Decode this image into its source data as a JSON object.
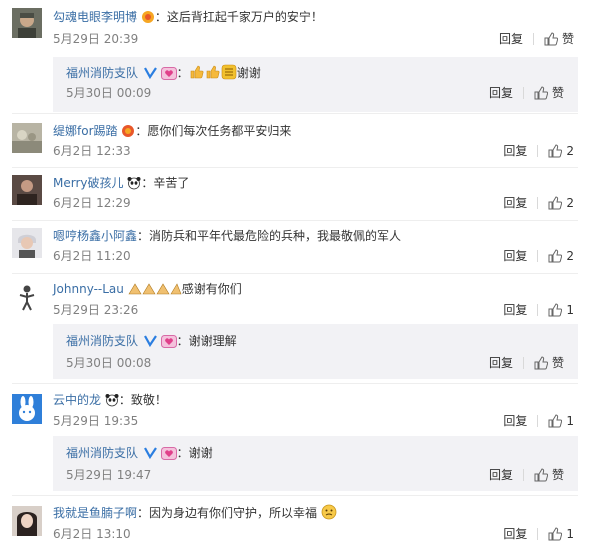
{
  "comments": [
    {
      "user": "勾魂电眼李明博",
      "text": "：这后背扛起千家万户的安宁！",
      "time": "5月29日 20:39",
      "reply": "回复",
      "like": "赞"
    },
    {
      "user": "缇娜for踢踏",
      "text": "：愿你们每次任务都平安归来",
      "time": "6月2日 12:33",
      "reply": "回复",
      "like": "2"
    },
    {
      "user": "Merry破孩儿",
      "text": "：辛苦了",
      "time": "6月2日 12:29",
      "reply": "回复",
      "like": "2"
    },
    {
      "user": "嗯哼杨鑫小阿鑫",
      "text": "：消防兵和平年代最危险的兵种，我最敬佩的军人",
      "time": "6月2日 11:20",
      "reply": "回复",
      "like": "2"
    },
    {
      "user": "Johnny--Lau",
      "text": "感谢有你们",
      "time": "5月29日 23:26",
      "reply": "回复",
      "like": "1"
    },
    {
      "user": "云中的龙",
      "text": "：致敬！",
      "time": "5月29日 19:35",
      "reply": "回复",
      "like": "1"
    },
    {
      "user": "我就是鱼腩子啊",
      "text": "：因为身边有你们守护，所以幸福",
      "time": "6月2日 13:10",
      "reply": "回复",
      "like": "1"
    }
  ],
  "replies": [
    {
      "user": "福州消防支队",
      "text": "谢谢",
      "time": "5月30日 00:09",
      "reply": "回复",
      "like": "赞"
    },
    {
      "user": "福州消防支队",
      "text": "：谢谢理解",
      "time": "5月30日 00:08",
      "reply": "回复",
      "like": "赞"
    },
    {
      "user": "福州消防支队",
      "text": "：谢谢",
      "time": "5月29日 19:47",
      "reply": "回复",
      "like": "赞"
    }
  ],
  "colors": {
    "username": "#3a6ea5",
    "meta": "#808080",
    "reply_bg": "#f2f2f5",
    "text": "#333333"
  },
  "icons": [
    "thumbs-up-icon",
    "verified-v-icon",
    "heart-badge-icon",
    "panda-icon",
    "sun-badge-icon",
    "emoji-icon"
  ]
}
